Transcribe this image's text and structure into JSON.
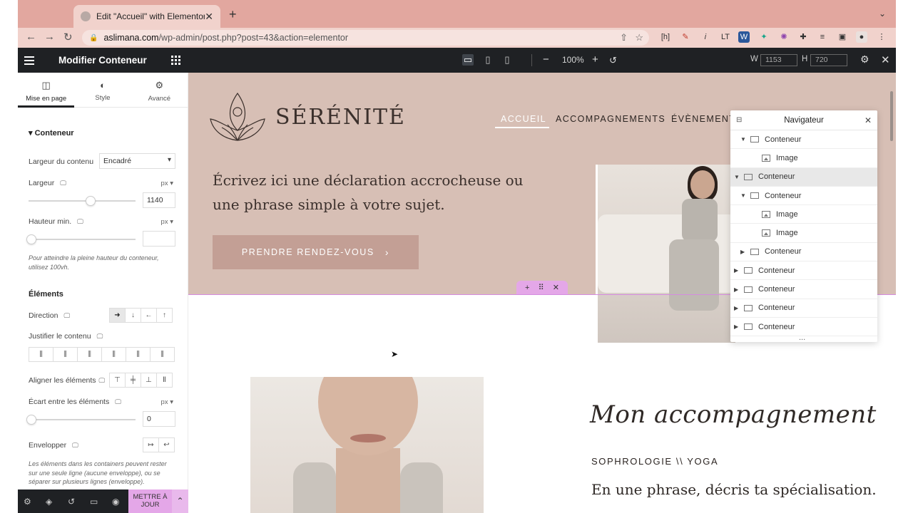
{
  "browser": {
    "tab_title": "Edit \"Accueil\" with Elementor",
    "url_host": "aslimana.com",
    "url_path": "/wp-admin/post.php?post=43&action=elementor"
  },
  "editor": {
    "panel_title": "Modifier Conteneur",
    "zoom": "100%",
    "width_label": "W",
    "width_value": "1153",
    "height_label": "H",
    "height_value": "720"
  },
  "panel": {
    "tabs": [
      {
        "label": "Mise en page",
        "icon": "layout-icon"
      },
      {
        "label": "Style",
        "icon": "contrast-icon"
      },
      {
        "label": "Avancé",
        "icon": "gear-icon"
      }
    ],
    "section_conteneur": "Conteneur",
    "content_width_label": "Largeur du contenu",
    "content_width_value": "Encadré",
    "width_label": "Largeur",
    "width_unit": "px",
    "width_value": "1140",
    "width_slider": 0.58,
    "min_height_label": "Hauteur min.",
    "min_height_unit": "px",
    "min_height_hint": "Pour atteindre la pleine hauteur du conteneur, utilisez 100vh.",
    "section_elements": "Éléments",
    "direction_label": "Direction",
    "justify_label": "Justifier le contenu",
    "align_label": "Aligner les éléments",
    "gap_label": "Écart entre les éléments",
    "gap_unit": "px",
    "gap_value": "0",
    "wrap_label": "Envelopper",
    "wrap_hint": "Les éléments dans les containers peuvent rester sur une seule ligne (aucune enveloppe), ou se séparer sur plusieurs lignes (enveloppe).",
    "update_label": "METTRE À JOUR"
  },
  "site": {
    "brand": "SÉRÉNITÉ",
    "menu": [
      "ACCUEIL",
      "ACCOMPAGNEMENTS",
      "ÉVÈNEMENT"
    ],
    "headline": "Écrivez ici une déclaration accrocheuse ou une phrase simple à votre sujet.",
    "cta": "PRENDRE RENDEZ-VOUS",
    "script_title": "Mon accompagnement",
    "subhead": "SOPHROLOGIE \\\\ YOGA",
    "lead": "En une phrase, décris ta spécialisation."
  },
  "navigator": {
    "title": "Navigateur",
    "rows": [
      {
        "label": "Conteneur",
        "type": "container",
        "arrow": "▼"
      },
      {
        "label": "Image",
        "type": "image",
        "arrow": ""
      },
      {
        "label": "Conteneur",
        "type": "container",
        "arrow": "▼"
      },
      {
        "label": "Conteneur",
        "type": "container",
        "arrow": "▼"
      },
      {
        "label": "Image",
        "type": "image",
        "arrow": ""
      },
      {
        "label": "Image",
        "type": "image",
        "arrow": ""
      },
      {
        "label": "Conteneur",
        "type": "container",
        "arrow": "▶"
      },
      {
        "label": "Conteneur",
        "type": "container",
        "arrow": "▶"
      },
      {
        "label": "Conteneur",
        "type": "container",
        "arrow": "▶"
      },
      {
        "label": "Conteneur",
        "type": "container",
        "arrow": "▶"
      },
      {
        "label": "Conteneur",
        "type": "container",
        "arrow": "▶"
      }
    ],
    "more": "..."
  },
  "colors": {
    "hero_bg": "#d7bfb5",
    "cta_bg": "#c39f95",
    "accent_pink": "#e4a7e8",
    "editor_dark": "#1f2124"
  }
}
